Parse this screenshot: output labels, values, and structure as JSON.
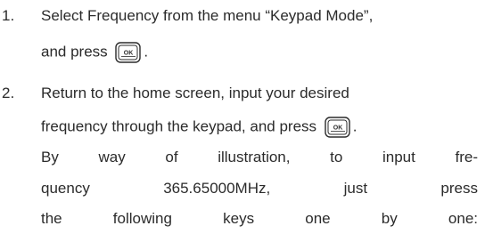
{
  "steps": [
    {
      "number": "1.",
      "line1": "Select Frequency from the menu “Keypad Mode”,",
      "line2_before": "and press",
      "line2_after": ".",
      "key_label": "OK"
    },
    {
      "number": "2.",
      "line1": "Return to the home screen, input your desired",
      "line2_before": "frequency through the keypad, and press",
      "line2_after": ".",
      "key_label": "OK",
      "line3": "By way of illustration, to input fre-",
      "line4": "quency 365.65000MHz, just press",
      "line5": "the following keys one by one:"
    }
  ]
}
